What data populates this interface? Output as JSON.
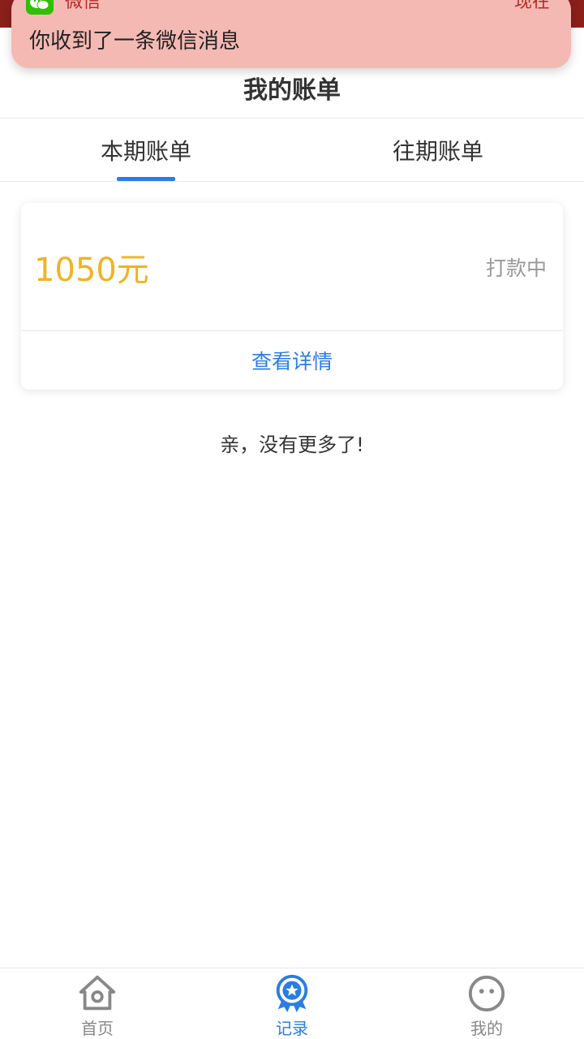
{
  "notification": {
    "app_name": "微信",
    "time": "现在",
    "message": "你收到了一条微信消息",
    "icon": "wechat-icon"
  },
  "header": {
    "title": "我的账单"
  },
  "tabs": [
    {
      "label": "本期账单",
      "active": true
    },
    {
      "label": "往期账单",
      "active": false
    }
  ],
  "bill": {
    "amount": "1050元",
    "status": "打款中",
    "detail_link": "查看详情"
  },
  "list_end_text": "亲，没有更多了!",
  "tabbar": [
    {
      "label": "首页",
      "icon": "home-icon",
      "active": false
    },
    {
      "label": "记录",
      "icon": "badge-star-icon",
      "active": true
    },
    {
      "label": "我的",
      "icon": "smiley-icon",
      "active": false
    }
  ],
  "colors": {
    "accent": "#2a7de1",
    "amount": "#f0b323",
    "notification_bg": "#f5b9b4"
  }
}
